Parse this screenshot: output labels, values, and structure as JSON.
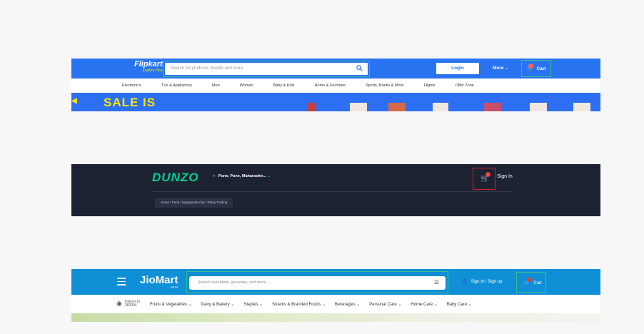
{
  "flipkart": {
    "logo": "Flipkart",
    "logo_sub": "Explore Plus",
    "search_placeholder": "Search for products, brands and more",
    "login_label": "Login",
    "more_label": "More",
    "cart_label": "Cart",
    "nav": [
      "Electronics",
      "TVs & Appliances",
      "Men",
      "Women",
      "Baby & Kids",
      "Home & Furniture",
      "Sports, Books & More",
      "Flights",
      "Offer Zone"
    ],
    "banner_text": "SALE IS",
    "brand_color": "#2874f0"
  },
  "dunzo": {
    "logo": "DUNZO",
    "location": "Pune, Pune, Maharashtr...",
    "cart_badge": "1",
    "signin_label": "Sign In",
    "breadcrumb": "Home / Pune / Magarpatta City / Relay Trading",
    "bg_color": "#1d2233",
    "accent": "#00d290"
  },
  "jiomart": {
    "logo": "JioMart",
    "logo_sub": "BETA",
    "search_placeholder": "Search essentials, groceries, and more ...",
    "signin_label": "Sign In / Sign up",
    "cart_label": "Cart",
    "deliver_label": "Deliver to",
    "pincode": "360004",
    "categories": [
      "Fruits & Vegetables",
      "Dairy & Bakery",
      "Staples",
      "Snacks & Branded Foods",
      "Beverages",
      "Personal Care",
      "Home Care",
      "Baby Care"
    ],
    "brand_color": "#0f8fd6"
  }
}
